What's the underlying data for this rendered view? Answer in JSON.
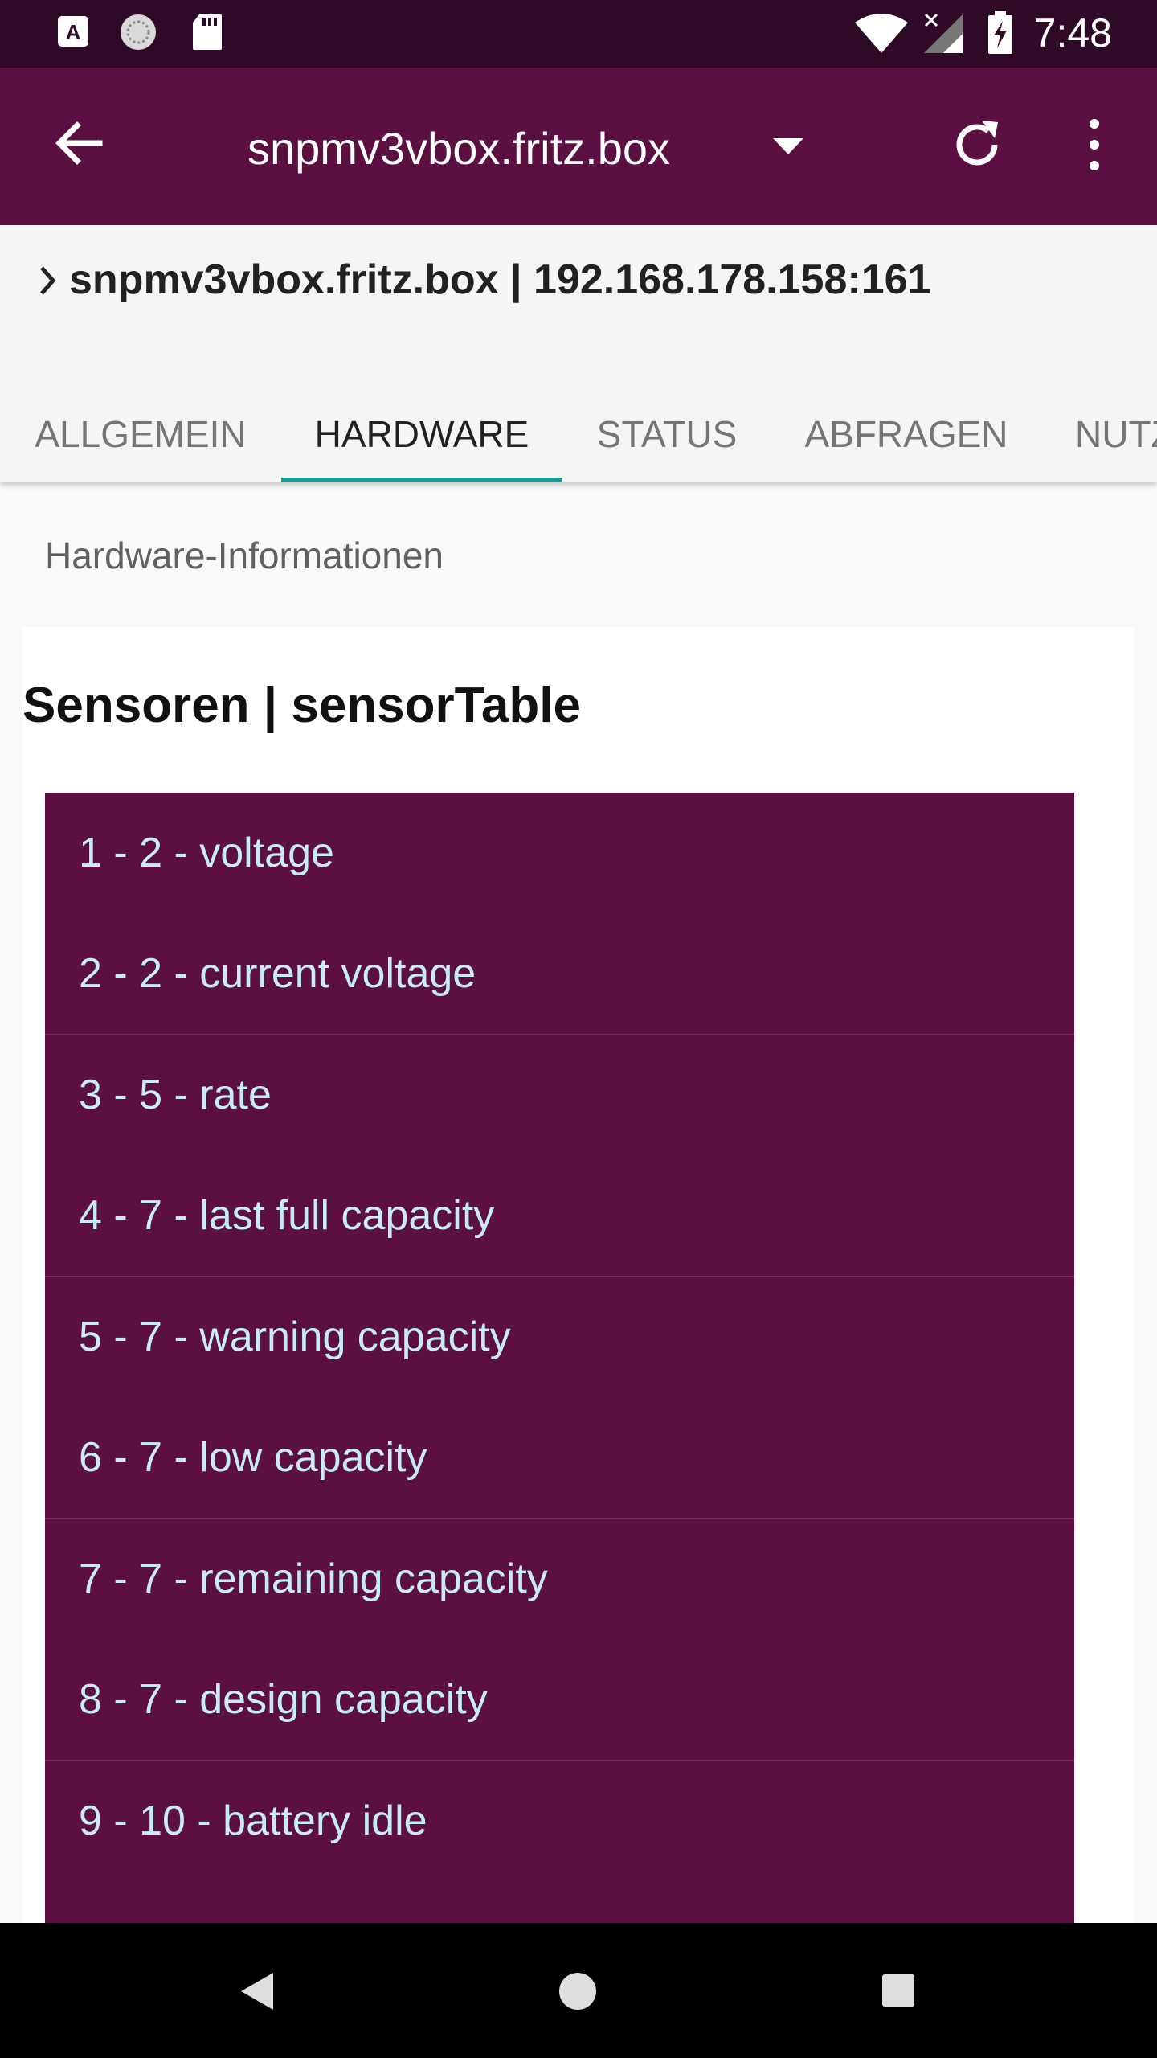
{
  "status_bar": {
    "time": "7:48",
    "icons": [
      "a-app-icon",
      "sync-circle-icon",
      "sd-card-icon",
      "wifi-icon",
      "no-signal-icon",
      "battery-charging-icon"
    ]
  },
  "app_bar": {
    "title": "snpmv3vbox.fritz.box",
    "icons": [
      "back-arrow-icon",
      "dropdown-caret-icon",
      "refresh-icon",
      "more-vert-icon"
    ]
  },
  "breadcrumb": "snpmv3vbox.fritz.box | 192.168.178.158:161",
  "tabs": [
    {
      "label": "ALLGEMEIN",
      "active": false
    },
    {
      "label": "HARDWARE",
      "active": true
    },
    {
      "label": "STATUS",
      "active": false
    },
    {
      "label": "ABFRAGEN",
      "active": false
    },
    {
      "label": "NUTZ",
      "active": false
    }
  ],
  "section_label": "Hardware-Informationen",
  "card": {
    "title": "Sensoren | sensorTable",
    "rows": [
      "1 - 2 - voltage",
      "2 - 2 - current voltage",
      "3 - 5 - rate",
      "4 - 7 - last full capacity",
      "5 - 7 - warning capacity",
      "6 - 7 - low capacity",
      "7 - 7 - remaining capacity",
      "8 - 7 - design capacity",
      "9 - 10 - battery idle"
    ]
  },
  "colors": {
    "primary": "#5c0f41",
    "status_bar": "#2e0a26",
    "accent": "#1a9a8c",
    "row_text": "#c7ecf7"
  },
  "nav_bar": {
    "icons": [
      "back-triangle-icon",
      "home-circle-icon",
      "recents-square-icon"
    ]
  }
}
